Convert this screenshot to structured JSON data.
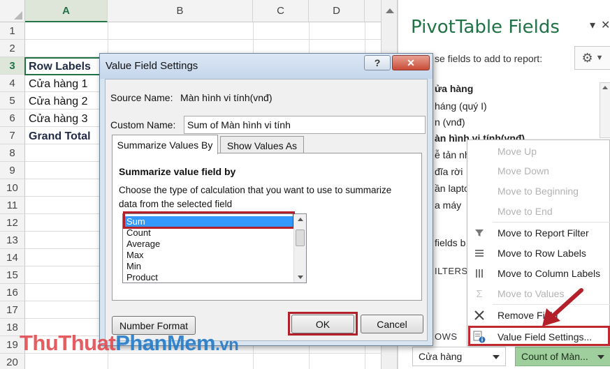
{
  "sheet": {
    "columns": [
      "A",
      "B",
      "C",
      "D"
    ],
    "rows": [
      "1",
      "2",
      "3",
      "4",
      "5",
      "6",
      "7",
      "8",
      "9",
      "10",
      "11",
      "12",
      "13",
      "14",
      "15",
      "16",
      "17",
      "18",
      "19",
      "20"
    ],
    "cells": {
      "row_labels": "Row Labels",
      "store1": "Cửa hàng 1",
      "store2": "Cửa hàng 2",
      "store3": "Cửa hàng 3",
      "grand_total": "Grand Total"
    }
  },
  "panel": {
    "title": "PivotTable Fields",
    "subtitle": "se fields to add to report:",
    "close_glyph": "✕",
    "dropdown_glyph": "▾",
    "fields": [
      "ửa hàng",
      "háng  (quý I)",
      "n (vnđ)",
      "àn hình vi tính(vnđ)",
      "ễ tản nh",
      "đĩa rời",
      "ần lapto",
      "a máy"
    ],
    "areas_hint": "fields b",
    "filters_label": "ILTERS",
    "rows_label": "OWS",
    "rows_dropdown": "Cửa hàng",
    "values_dropdown": "Count of Màn..."
  },
  "context_menu": {
    "items": [
      {
        "label": "Move Up",
        "icon": "",
        "disabled": true
      },
      {
        "label": "Move Down",
        "icon": "",
        "disabled": true
      },
      {
        "label": "Move to Beginning",
        "icon": "",
        "disabled": true
      },
      {
        "label": "Move to End",
        "icon": "",
        "disabled": true
      },
      {
        "label": "Move to Report Filter",
        "icon": "filter-icon",
        "disabled": false
      },
      {
        "label": "Move to Row Labels",
        "icon": "rows-icon",
        "disabled": false
      },
      {
        "label": "Move to Column Labels",
        "icon": "columns-icon",
        "disabled": false
      },
      {
        "label": "Move to Values",
        "icon": "sigma-icon",
        "disabled": true
      },
      {
        "label": "Remove Field",
        "icon": "remove-icon",
        "disabled": false
      },
      {
        "label": "Value Field Settings...",
        "icon": "settings-icon",
        "disabled": false
      }
    ]
  },
  "dialog": {
    "title": "Value Field Settings",
    "help_label": "?",
    "close_label": "✕",
    "source_label": "Source Name:",
    "source_value": "Màn hình vi tính(vnđ)",
    "custom_label": "Custom Name:",
    "custom_value": "Sum of Màn hình vi tính",
    "tabs": [
      "Summarize Values By",
      "Show Values As"
    ],
    "section_title": "Summarize value field by",
    "description_line1": "Choose the type of calculation that you want to use to summarize",
    "description_line2": "data from the selected field",
    "functions": [
      "Sum",
      "Count",
      "Average",
      "Max",
      "Min",
      "Product"
    ],
    "selected_function": "Sum",
    "number_format_label": "Number Format",
    "ok_label": "OK",
    "cancel_label": "Cancel"
  },
  "watermark": {
    "part1": "ThuThuat",
    "part2": "PhanMem",
    "part3": ".vn"
  },
  "colors": {
    "excel_green": "#217346",
    "highlight_red": "#b4202a",
    "selection_blue": "#3399ff"
  }
}
